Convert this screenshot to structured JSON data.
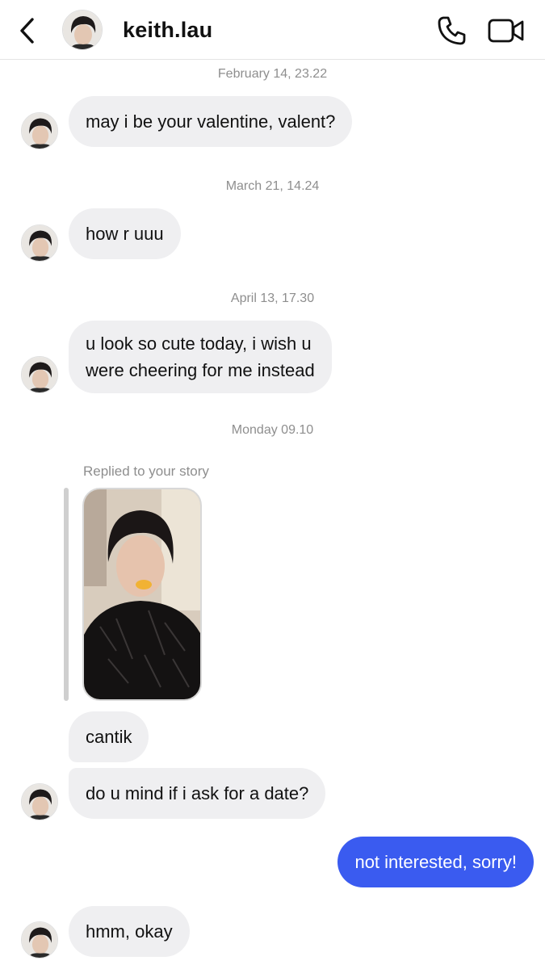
{
  "header": {
    "username": "keith.lau",
    "back_icon": "chevron-left-icon",
    "call_icon": "phone-icon",
    "video_icon": "video-camera-icon"
  },
  "messages": [
    {
      "timestamp": "February 14, 23.22",
      "text": "may i be your valentine, valent?"
    },
    {
      "timestamp": "March 21, 14.24",
      "text": "how r uuu"
    },
    {
      "timestamp": "April 13, 17.30",
      "text_line1": "u look so cute today, i wish u",
      "text_line2": "were cheering for me instead"
    },
    {
      "timestamp": "Monday 09.10",
      "reply_label": "Replied to your story",
      "text": "cantik"
    },
    {
      "text": "do u mind if i ask for a date?"
    },
    {
      "text": "not interested, sorry!",
      "sender": "me"
    },
    {
      "text": "hmm, okay"
    }
  ],
  "colors": {
    "my_bubble": "#3a5bf0",
    "their_bubble": "#efeff1",
    "timestamp": "#8e8e8e"
  }
}
